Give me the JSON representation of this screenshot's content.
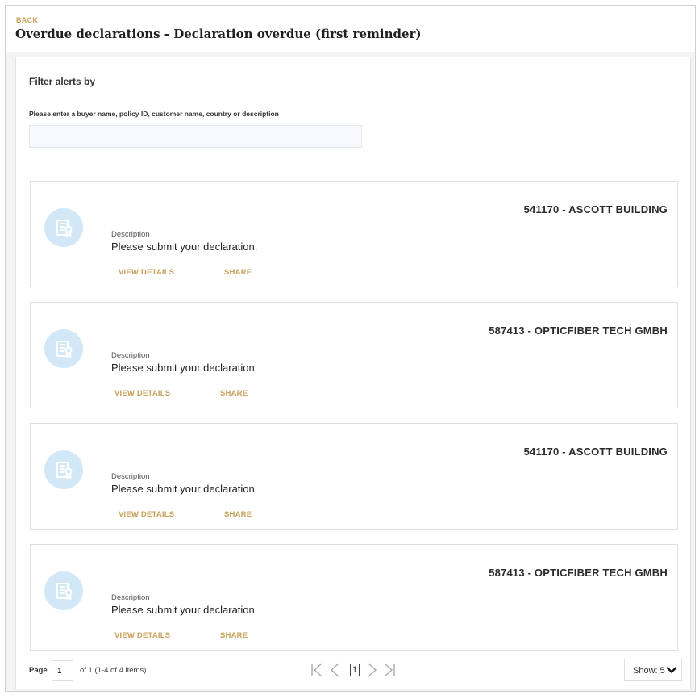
{
  "header": {
    "back_label": "BACK",
    "title": "Overdue declarations - Declaration overdue (first reminder)"
  },
  "filter": {
    "heading": "Filter alerts by",
    "search_label": "Please enter a buyer name, policy ID, customer name, country or description",
    "search_value": ""
  },
  "alerts": [
    {
      "title": "541170 - ASCOTT BUILDING",
      "description_label": "Description",
      "description": "Please submit your declaration.",
      "view_details_label": "VIEW DETAILS",
      "share_label": "SHARE",
      "icon": "certificate-document-icon"
    },
    {
      "title": "587413 - OPTICFIBER TECH GMBH",
      "description_label": "Description",
      "description": "Please submit your declaration.",
      "view_details_label": "VIEW DETAILS",
      "share_label": "SHARE",
      "icon": "certificate-document-icon"
    },
    {
      "title": "541170 - ASCOTT BUILDING",
      "description_label": "Description",
      "description": "Please submit your declaration.",
      "view_details_label": "VIEW DETAILS",
      "share_label": "SHARE",
      "icon": "certificate-document-icon"
    },
    {
      "title": "587413 - OPTICFIBER TECH GMBH",
      "description_label": "Description",
      "description": "Please submit your declaration.",
      "view_details_label": "VIEW DETAILS",
      "share_label": "SHARE",
      "icon": "certificate-document-icon"
    }
  ],
  "pagination": {
    "page_label": "Page",
    "page_value": "1",
    "of_text": "of 1 (1-4 of 4 items)",
    "current_page": "1",
    "show_label": "Show: 5",
    "icons": [
      "first-page-icon",
      "previous-page-icon",
      "next-page-icon",
      "last-page-icon",
      "chevron-down-icon"
    ]
  },
  "colors": {
    "accent": "#c9a15a",
    "icon_bg": "#d3e8f6",
    "icon_fg": "#ffffff",
    "pager_icon": "#a8a8a8",
    "page_bg": "#f4f4f4"
  }
}
